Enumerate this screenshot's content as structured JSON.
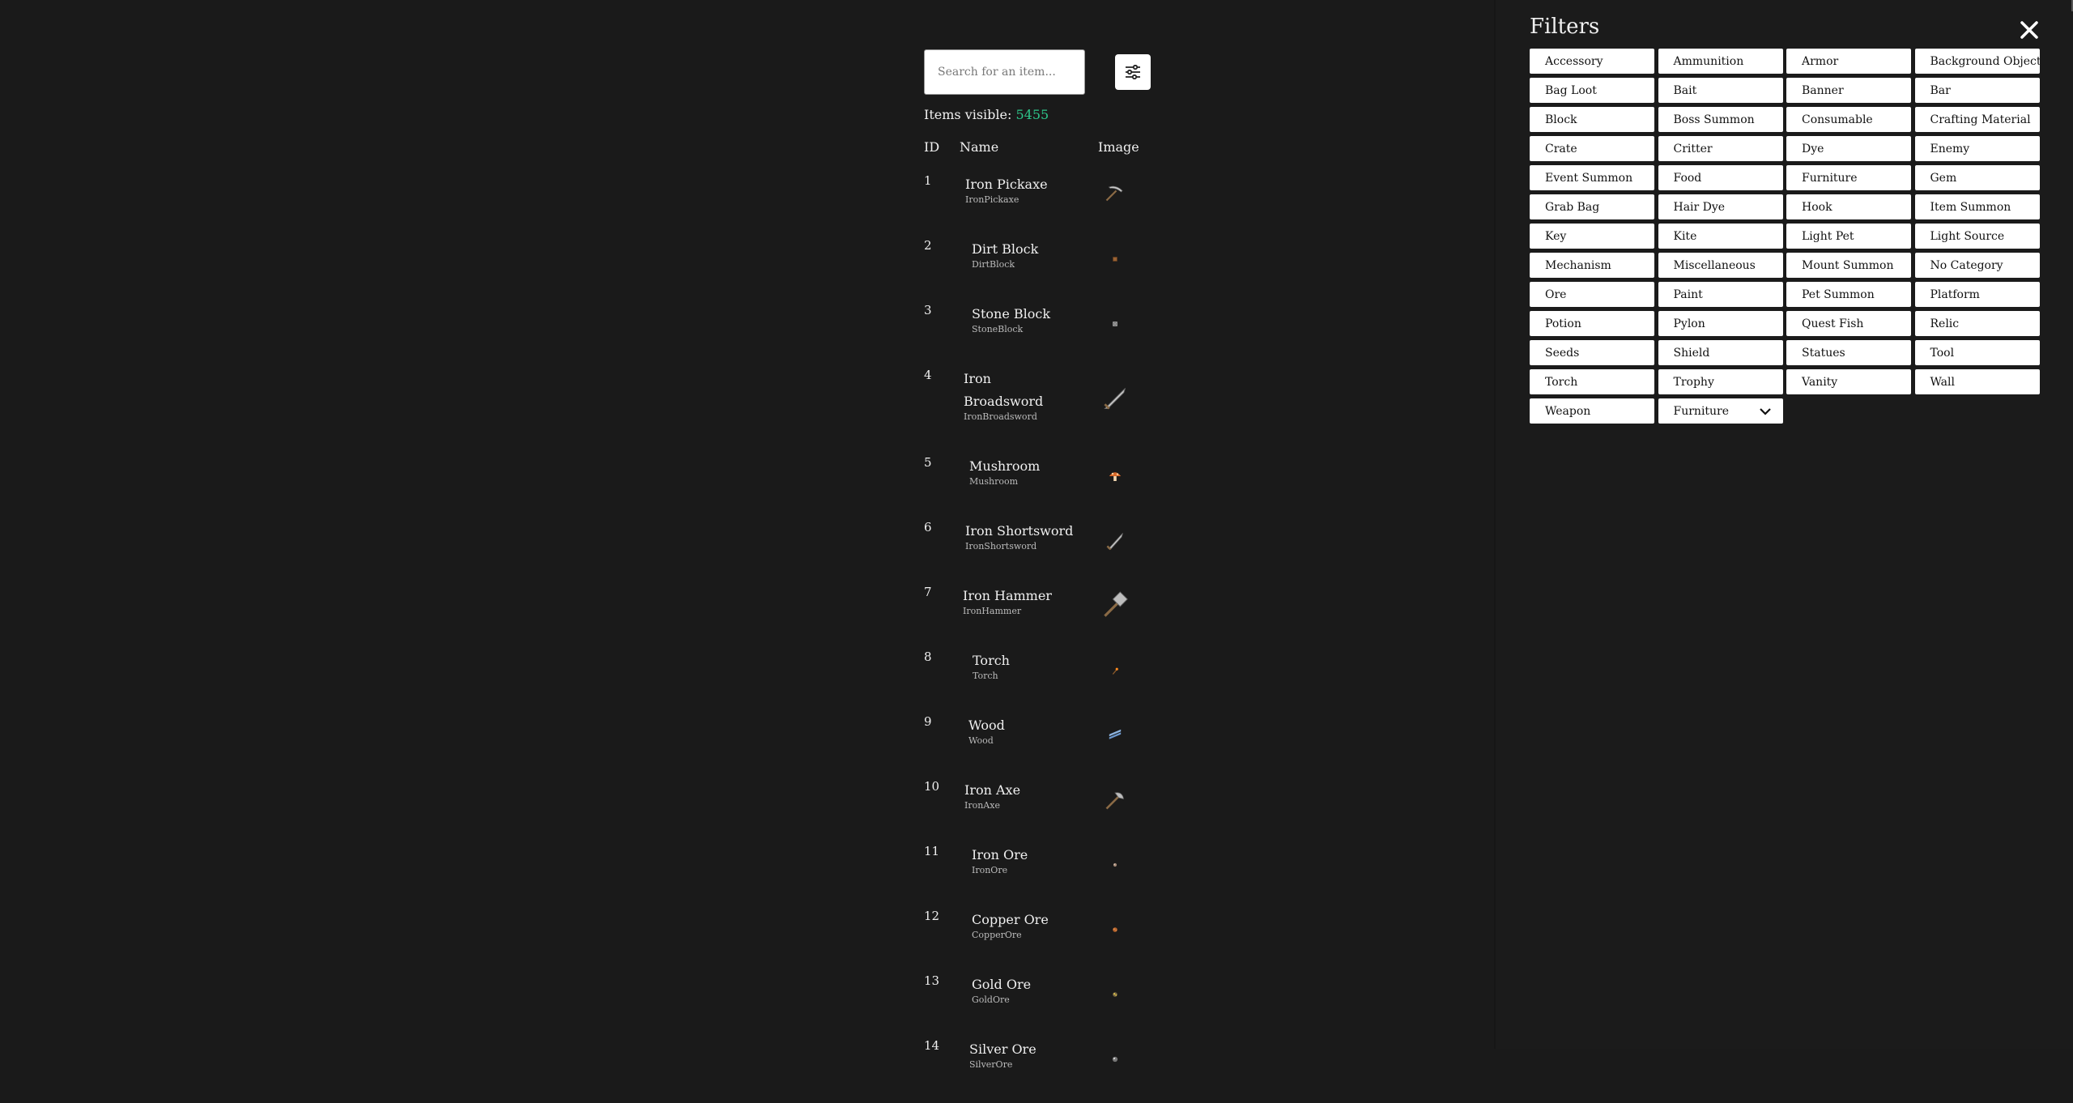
{
  "search": {
    "placeholder": "Search for an item..."
  },
  "summary": {
    "label": "Items visible:",
    "count": "5455"
  },
  "table": {
    "headers": {
      "id": "ID",
      "name": "Name",
      "image": "Image"
    },
    "rows": [
      {
        "id": "1",
        "name": [
          "Iron Pickaxe"
        ],
        "internal": "IronPickaxe",
        "icon": "pickaxe-icon"
      },
      {
        "id": "2",
        "name": [
          "Dirt Block"
        ],
        "internal": "DirtBlock",
        "icon": "dirt-block-icon"
      },
      {
        "id": "3",
        "name": [
          "Stone Block"
        ],
        "internal": "StoneBlock",
        "icon": "stone-block-icon"
      },
      {
        "id": "4",
        "name": [
          "Iron",
          "Broadsword"
        ],
        "internal": "IronBroadsword",
        "icon": "broadsword-icon"
      },
      {
        "id": "5",
        "name": [
          "Mushroom"
        ],
        "internal": "Mushroom",
        "icon": "mushroom-icon"
      },
      {
        "id": "6",
        "name": [
          "Iron Shortsword"
        ],
        "internal": "IronShortsword",
        "icon": "shortsword-icon"
      },
      {
        "id": "7",
        "name": [
          "Iron Hammer"
        ],
        "internal": "IronHammer",
        "icon": "hammer-icon"
      },
      {
        "id": "8",
        "name": [
          "Torch"
        ],
        "internal": "Torch",
        "icon": "torch-icon"
      },
      {
        "id": "9",
        "name": [
          "Wood"
        ],
        "internal": "Wood",
        "icon": "wood-icon"
      },
      {
        "id": "10",
        "name": [
          "Iron Axe"
        ],
        "internal": "IronAxe",
        "icon": "axe-icon"
      },
      {
        "id": "11",
        "name": [
          "Iron Ore"
        ],
        "internal": "IronOre",
        "icon": "iron-ore-icon"
      },
      {
        "id": "12",
        "name": [
          "Copper Ore"
        ],
        "internal": "CopperOre",
        "icon": "copper-ore-icon"
      },
      {
        "id": "13",
        "name": [
          "Gold Ore"
        ],
        "internal": "GoldOre",
        "icon": "gold-ore-icon"
      },
      {
        "id": "14",
        "name": [
          "Silver Ore"
        ],
        "internal": "SilverOre",
        "icon": "silver-ore-icon"
      }
    ]
  },
  "filters": {
    "title": "Filters",
    "categories": [
      "Accessory",
      "Ammunition",
      "Armor",
      "Background Object",
      "Bag Loot",
      "Bait",
      "Banner",
      "Bar",
      "Block",
      "Boss Summon",
      "Consumable",
      "Crafting Material",
      "Crate",
      "Critter",
      "Dye",
      "Enemy",
      "Event Summon",
      "Food",
      "Furniture",
      "Gem",
      "Grab Bag",
      "Hair Dye",
      "Hook",
      "Item Summon",
      "Key",
      "Kite",
      "Light Pet",
      "Light Source",
      "Mechanism",
      "Miscellaneous",
      "Mount Summon",
      "No Category",
      "Ore",
      "Paint",
      "Pet Summon",
      "Platform",
      "Potion",
      "Pylon",
      "Quest Fish",
      "Relic",
      "Seeds",
      "Shield",
      "Statues",
      "Tool",
      "Torch",
      "Trophy",
      "Vanity",
      "Wall",
      "Weapon"
    ],
    "subcategory_select": {
      "value": "Furniture"
    }
  },
  "colors": {
    "background": "#1a1a1a",
    "accent": "#2ec58a",
    "chip": "#ffffff"
  }
}
